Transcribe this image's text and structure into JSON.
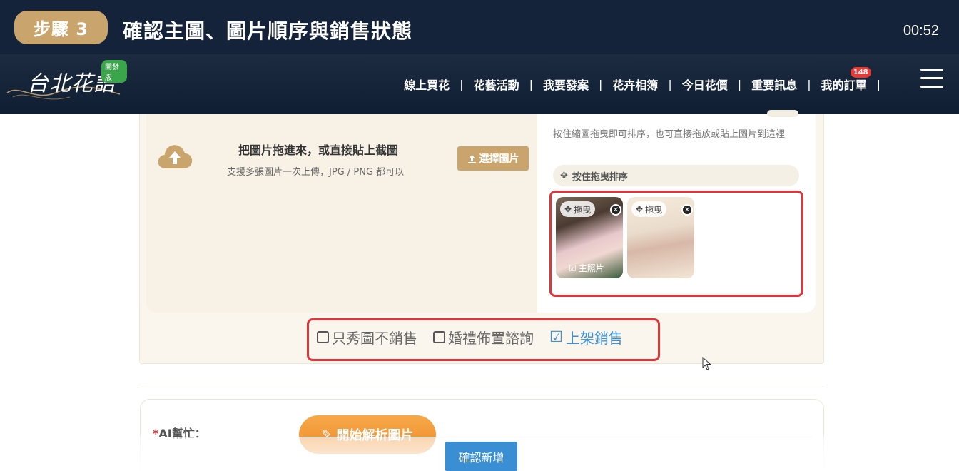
{
  "step": {
    "badge": "步驟 3",
    "title": "確認主圖、圖片順序與銷售狀態",
    "time": "00:52"
  },
  "nav": {
    "logo_text": "台北花語",
    "logo_badge": "開發版",
    "items": [
      {
        "label": "線上買花"
      },
      {
        "label": "花藝活動"
      },
      {
        "label": "我要發案"
      },
      {
        "label": "花卉相簿"
      },
      {
        "label": "今日花價"
      },
      {
        "label": "重要訊息"
      },
      {
        "label": "我的訂單",
        "badge": "148"
      }
    ]
  },
  "upload": {
    "drop_title": "把圖片拖進來，或直接貼上截圖",
    "drop_subtitle": "支援多張圖片一次上傳，JPG / PNG 都可以",
    "choose_button": "選擇圖片",
    "hint": "按住縮圖拖曳即可排序，也可直接拖放或貼上圖片到這裡",
    "sort_bar": "按住拖曳排序",
    "thumbs": [
      {
        "drag_label": "拖曳",
        "main_label": "主照片",
        "is_main": true
      },
      {
        "drag_label": "拖曳",
        "is_main": false
      }
    ]
  },
  "sale_status": {
    "options": [
      {
        "label": "只秀圖不銷售",
        "checked": false
      },
      {
        "label": "婚禮佈置諮詢",
        "checked": false
      },
      {
        "label": "上架銷售",
        "checked": true
      }
    ]
  },
  "ai": {
    "required_mark": "*",
    "label": "AI幫忙：",
    "button": "開始解析圖片"
  },
  "confirm_button": "確認新增",
  "colors": {
    "header_bg": "#14233a",
    "gold": "#c9a46c",
    "highlight_red": "#e0353b",
    "checked_blue": "#3b8ed8",
    "confirm_blue": "#3a8ed3",
    "ai_orange": "#f08a28"
  }
}
